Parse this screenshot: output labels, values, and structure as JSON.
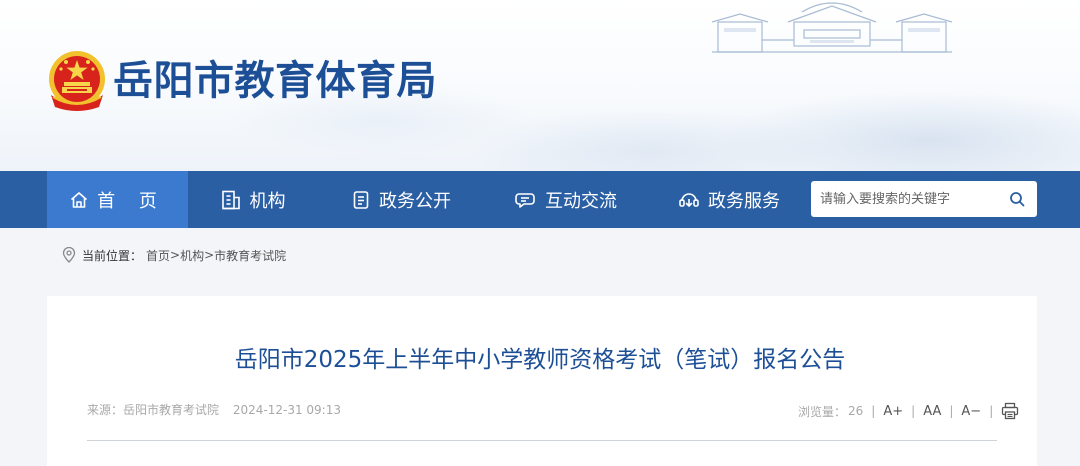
{
  "header": {
    "site_title": "岳阳市教育体育局",
    "emblem_icon": "national-emblem-icon"
  },
  "nav": {
    "items": [
      {
        "label": "首 页",
        "icon": "home-icon"
      },
      {
        "label": "机构",
        "icon": "organization-icon"
      },
      {
        "label": "政务公开",
        "icon": "document-icon"
      },
      {
        "label": "互动交流",
        "icon": "chat-icon"
      },
      {
        "label": "政务服务",
        "icon": "service-icon"
      }
    ],
    "active_index": 0,
    "search_placeholder": "请输入要搜索的关键字",
    "colors": {
      "bar": "#2b5fa4",
      "active": "#3c7ad0"
    }
  },
  "breadcrumb": {
    "prefix": "当前位置：",
    "items": [
      "首页",
      "机构",
      "市教育考试院"
    ],
    "separator": ">"
  },
  "article": {
    "title": "岳阳市2025年上半年中小学教师资格考试（笔试）报名公告",
    "source": "来源：岳阳市教育考试院",
    "date": "2024-12-31 09:13",
    "views_label": "浏览量：",
    "views": "26",
    "font_larger": "A+",
    "font_reset": "AA",
    "font_smaller": "A−",
    "print_icon": "print-icon"
  }
}
